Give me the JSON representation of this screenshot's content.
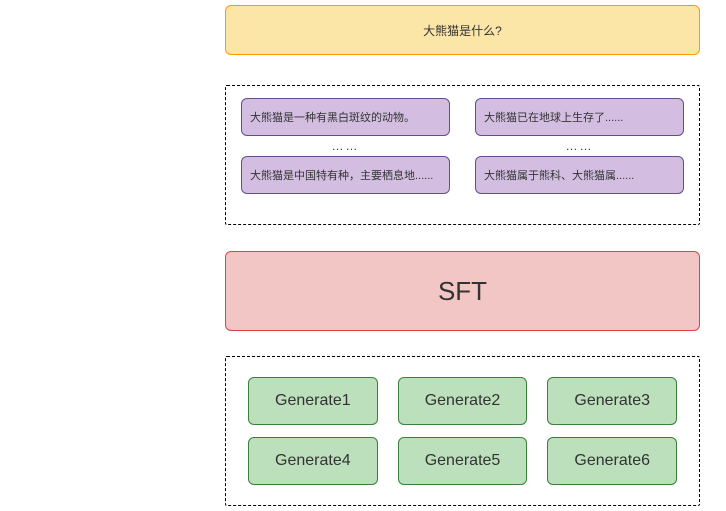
{
  "question": {
    "text": "大熊猫是什么?"
  },
  "samples": {
    "row1": {
      "left": "大熊猫是一种有黑白斑纹的动物。",
      "right": "大熊猫已在地球上生存了......"
    },
    "ellipsis": {
      "left": "……",
      "right": "……"
    },
    "row2": {
      "left": "大熊猫是中国特有种，主要栖息地......",
      "right": "大熊猫属于熊科、大熊猫属......"
    }
  },
  "sft": {
    "label": "SFT"
  },
  "generates": {
    "row1": {
      "g1": "Generate1",
      "g2": "Generate2",
      "g3": "Generate3"
    },
    "row2": {
      "g4": "Generate4",
      "g5": "Generate5",
      "g6": "Generate6"
    }
  }
}
